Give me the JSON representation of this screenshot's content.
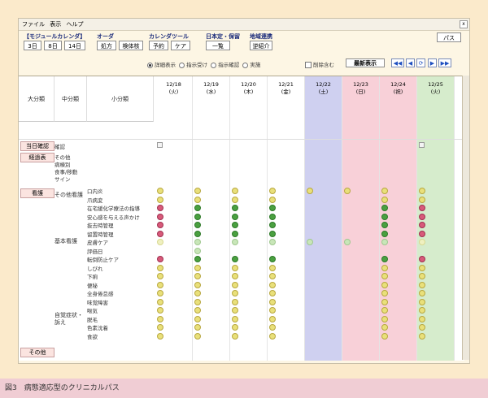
{
  "menubar": {
    "items": [
      "ファイル",
      "表示",
      "ヘルプ"
    ],
    "close": "x"
  },
  "toolbar": {
    "module_calendar": {
      "title": "【モジュールカレンダ】",
      "buttons": [
        "3日",
        "8日",
        "14日"
      ]
    },
    "order": {
      "title": "オーダ",
      "buttons": [
        "処方",
        "検体核"
      ]
    },
    "calendar_tool": {
      "title": "カレンダツール",
      "buttons": [
        "予約",
        "ケア"
      ]
    },
    "schedule": {
      "title": "日本定・保留",
      "buttons": [
        "一覧"
      ]
    },
    "regional": {
      "title": "地域連携",
      "buttons": [
        "逆紹介"
      ]
    },
    "path_button": "パス"
  },
  "view_options": {
    "radios": [
      "詳細表示",
      "指示受け",
      "指示確認",
      "実施"
    ],
    "selected": 0,
    "checkbox": "削除含む",
    "latest_button": "最新表示",
    "nav": [
      "◀◀",
      "◀",
      "⟳",
      "▶",
      "▶▶"
    ]
  },
  "headers": {
    "major": "大分類",
    "middle": "中分類",
    "minor": "小分類"
  },
  "dates": [
    {
      "date": "12/18",
      "day": "(火)",
      "color": "#fff"
    },
    {
      "date": "12/19",
      "day": "(水)",
      "color": "#fff"
    },
    {
      "date": "12/20",
      "day": "(木)",
      "color": "#fff"
    },
    {
      "date": "12/21",
      "day": "(金)",
      "color": "#fff"
    },
    {
      "date": "12/22",
      "day": "(土)",
      "color": "#cfd0f0"
    },
    {
      "date": "12/23",
      "day": "(日)",
      "color": "#f8d0d8"
    },
    {
      "date": "12/24",
      "day": "(祝)",
      "color": "#f8d0d8"
    },
    {
      "date": "12/25",
      "day": "(火)",
      "color": "#d6eccc"
    }
  ],
  "sections": {
    "today_confirm": {
      "cat": "当日確認",
      "item": "確認"
    },
    "progress": {
      "cat": "経過表",
      "items": [
        "その他",
        "病棟別",
        "食事/移動",
        "サイン"
      ]
    },
    "nursing": {
      "cat": "看護",
      "sub1": "その他看護",
      "sub2": "基本看護",
      "sub3": "自覚症状・訴え"
    },
    "other": {
      "cat": "その他"
    }
  },
  "rows": [
    {
      "label": "口内炎",
      "icons": [
        "y",
        "y",
        "y",
        "y",
        "y",
        "y",
        "y",
        "y"
      ]
    },
    {
      "label": "爪病変",
      "icons": [
        "y",
        "y",
        "y",
        "y",
        "",
        "",
        "y",
        "y"
      ]
    },
    {
      "label": "在宅緩化学療法の指導",
      "icons": [
        "r",
        "g",
        "g",
        "g",
        "",
        "",
        "g",
        "r"
      ]
    },
    {
      "label": "安心感を与える声かけ",
      "icons": [
        "r",
        "g",
        "g",
        "g",
        "",
        "",
        "g",
        "r"
      ]
    },
    {
      "label": "抜去時管理",
      "icons": [
        "r",
        "g",
        "g",
        "g",
        "",
        "",
        "g",
        "r"
      ]
    },
    {
      "label": "留置時管理",
      "icons": [
        "r",
        "g",
        "g",
        "g",
        "",
        "",
        "g",
        "r"
      ]
    },
    {
      "label": "皮膚ケア",
      "icons": [
        "ly",
        "lg",
        "lg",
        "lg",
        "lg",
        "lg",
        "lg",
        "ly"
      ]
    },
    {
      "label": "評価日",
      "icons": [
        "",
        "lg",
        "",
        "",
        "",
        "",
        "",
        ""
      ]
    },
    {
      "label": "転倒防止ケア",
      "icons": [
        "r",
        "g",
        "g",
        "g",
        "",
        "",
        "g",
        "r"
      ]
    },
    {
      "label": "しびれ",
      "icons": [
        "y",
        "y",
        "y",
        "y",
        "",
        "",
        "y",
        "y"
      ]
    },
    {
      "label": "下痢",
      "icons": [
        "y",
        "y",
        "y",
        "y",
        "",
        "",
        "y",
        "y"
      ]
    },
    {
      "label": "便秘",
      "icons": [
        "y",
        "y",
        "y",
        "y",
        "",
        "",
        "y",
        "y"
      ]
    },
    {
      "label": "全身倦怠感",
      "icons": [
        "y",
        "y",
        "y",
        "y",
        "",
        "",
        "y",
        "y"
      ]
    },
    {
      "label": "味覚障害",
      "icons": [
        "y",
        "y",
        "y",
        "y",
        "",
        "",
        "y",
        "y"
      ]
    },
    {
      "label": "嘔気",
      "icons": [
        "y",
        "y",
        "y",
        "y",
        "",
        "",
        "y",
        "y"
      ]
    },
    {
      "label": "脱毛",
      "icons": [
        "y",
        "y",
        "y",
        "y",
        "",
        "",
        "y",
        "y"
      ]
    },
    {
      "label": "色素沈着",
      "icons": [
        "y",
        "y",
        "y",
        "y",
        "",
        "",
        "y",
        "y"
      ]
    },
    {
      "label": "食欲",
      "icons": [
        "y",
        "y",
        "y",
        "y",
        "",
        "",
        "y",
        "y"
      ]
    }
  ],
  "caption": "図3　病態適応型のクリニカルパス"
}
